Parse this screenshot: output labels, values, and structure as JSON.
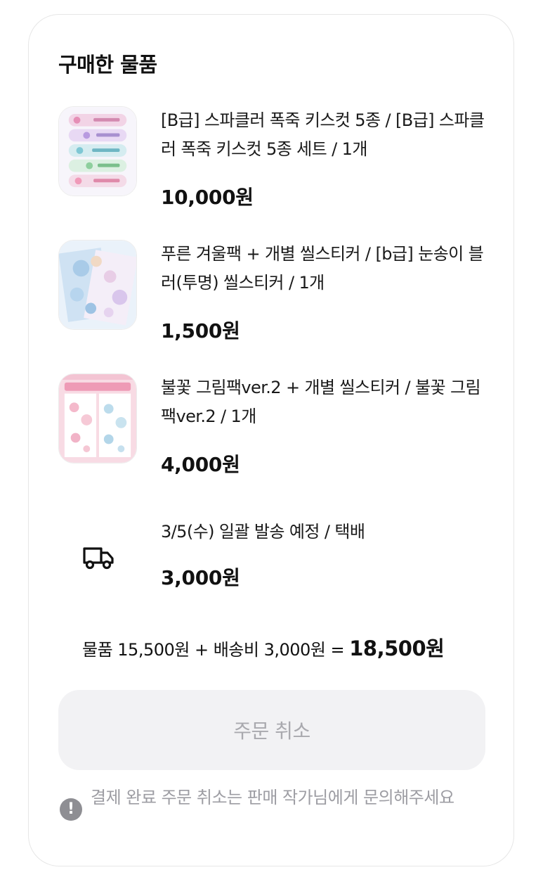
{
  "section_title": "구매한 물품",
  "items": [
    {
      "name": "[B급] 스파클러 폭죽 키스컷 5종 / [B급] 스파클러 폭죽 키스컷 5종 세트 / 1개",
      "price": "10,000원",
      "thumb_icon": "sparkler-sticker-image"
    },
    {
      "name": "푸른 겨울팩 + 개별 씰스티커 / [b급] 눈송이 블러(투명) 씰스티커 / 1개",
      "price": "1,500원",
      "thumb_icon": "winter-pack-sticker-image"
    },
    {
      "name": "불꽃 그림팩ver.2 + 개별 씰스티커 / 불꽃 그림팩ver.2 / 1개",
      "price": "4,000원",
      "thumb_icon": "flower-pack-sticker-image"
    }
  ],
  "shipping": {
    "icon": "truck-icon",
    "label": "3/5(수) 일괄 발송 예정 / 택배",
    "price": "3,000원"
  },
  "summary": {
    "prefix": "물품 15,500원 + 배송비 3,000원 = ",
    "total": "18,500원"
  },
  "cancel_button": "주문 취소",
  "notice": {
    "icon": "exclamation-icon",
    "text": "결제 완료 주문 취소는 판매 작가님에게 문의해주세요"
  },
  "colors": {
    "accent_text": "#111111",
    "muted": "#9d9da3",
    "button_bg": "#f2f2f4"
  }
}
